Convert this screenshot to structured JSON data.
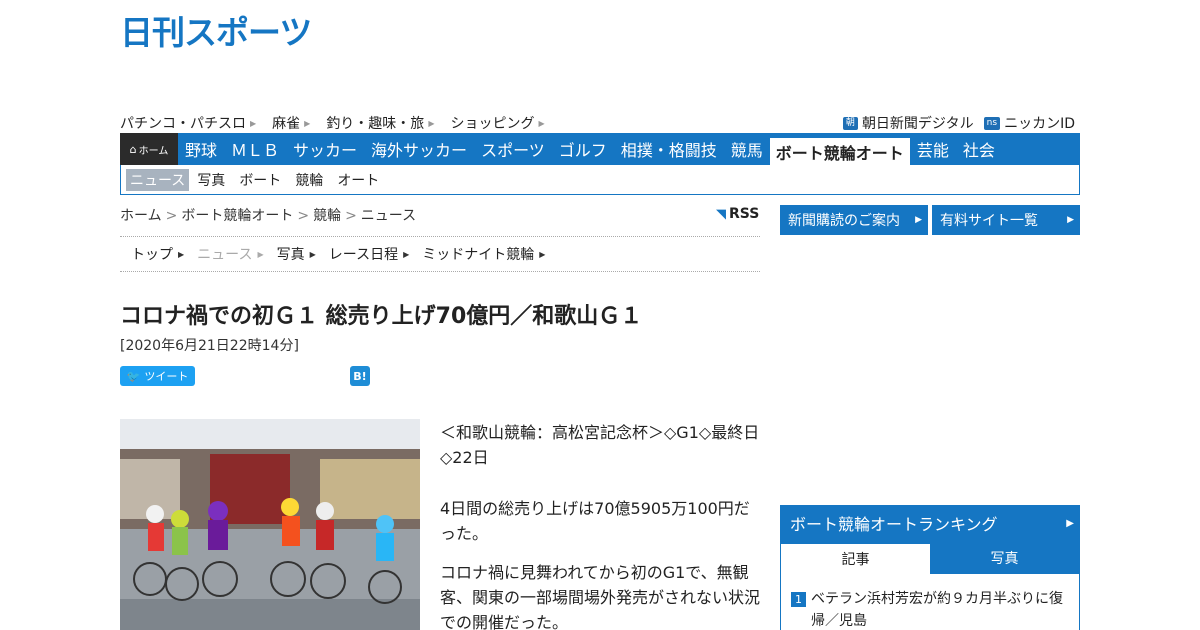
{
  "brand": {
    "logo_text": "日刊スポーツ",
    "accent": "#1576c3"
  },
  "top_links": [
    {
      "label": "パチンコ・パチスロ"
    },
    {
      "label": "麻雀"
    },
    {
      "label": "釣り・趣味・旅"
    },
    {
      "label": "ショッピング"
    }
  ],
  "top_right_links": [
    {
      "badge": "朝",
      "label": "朝日新聞デジタル"
    },
    {
      "badge": "ns",
      "label": "ニッカンID"
    }
  ],
  "main_nav": {
    "home_label": "ホーム",
    "items": [
      {
        "label": "野球"
      },
      {
        "label": "ＭＬＢ"
      },
      {
        "label": "サッカー"
      },
      {
        "label": "海外サッカー"
      },
      {
        "label": "スポーツ"
      },
      {
        "label": "ゴルフ"
      },
      {
        "label": "相撲・格闘技"
      },
      {
        "label": "競馬"
      },
      {
        "label": "ボート競輪オート"
      },
      {
        "label": "芸能"
      },
      {
        "label": "社会"
      }
    ],
    "active_index": 8
  },
  "sub_nav": {
    "items": [
      {
        "label": "ニュース"
      },
      {
        "label": "写真"
      },
      {
        "label": "ボート"
      },
      {
        "label": "競輪"
      },
      {
        "label": "オート"
      }
    ],
    "active_index": 0
  },
  "breadcrumb": [
    "ホーム",
    "ボート競輪オート",
    "競輪",
    "ニュース"
  ],
  "rss_label": "RSS",
  "section_tabs": {
    "items": [
      {
        "label": "トップ"
      },
      {
        "label": "ニュース"
      },
      {
        "label": "写真"
      },
      {
        "label": "レース日程"
      },
      {
        "label": "ミッドナイト競輪"
      }
    ],
    "active_index": 1
  },
  "article": {
    "title": "コロナ禍での初Ｇ１ 総売り上げ70億円／和歌山Ｇ１",
    "date": "[2020年6月21日22時14分]",
    "tweet_label": "ツイート",
    "hatena_label": "B!",
    "paragraphs": [
      "＜和歌山競輪：高松宮記念杯＞◇G1◇最終日◇22日",
      "4日間の総売り上げは70億5905万100円だった。",
      "コロナ禍に見舞われてから初のG1で、無観客、関東の一部場間場外発売がされない状況での開催だった。"
    ]
  },
  "sidebar": {
    "buttons": [
      {
        "label": "新聞購読のご案内"
      },
      {
        "label": "有料サイト一覧"
      }
    ],
    "ranking": {
      "title": "ボート競輪オートランキング",
      "tabs": [
        {
          "label": "記事"
        },
        {
          "label": "写真"
        }
      ],
      "items": [
        {
          "rank": "1",
          "text": "ベテラン浜村芳宏が約９カ月半ぶりに復帰／児島"
        }
      ]
    }
  }
}
